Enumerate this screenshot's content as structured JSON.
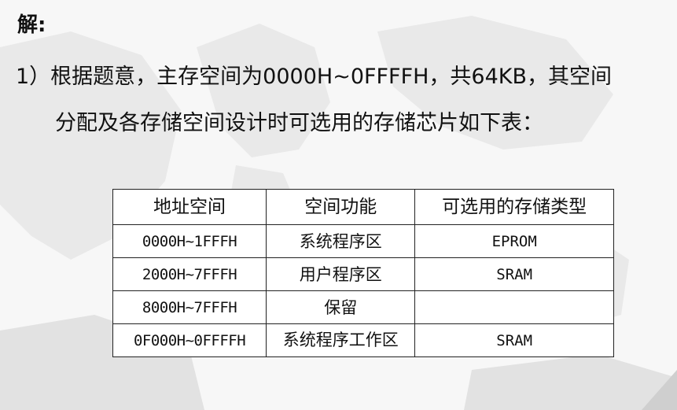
{
  "solution": {
    "label": "解:",
    "paragraph_line1": "1）根据题意，主存空间为0000H~0FFFFH，共64KB，其空间",
    "paragraph_line2": "分配及各存储空间设计时可选用的存储芯片如下表："
  },
  "table": {
    "headers": [
      "地址空间",
      "空间功能",
      "可选用的存储类型"
    ],
    "rows": [
      [
        "0000H~1FFFH",
        "系统程序区",
        "EPROM"
      ],
      [
        "2000H~7FFFH",
        "用户程序区",
        "SRAM"
      ],
      [
        "8000H~7FFFH",
        "保留",
        ""
      ],
      [
        "0F000H~0FFFFH",
        "系统程序工作区",
        "SRAM"
      ]
    ]
  }
}
